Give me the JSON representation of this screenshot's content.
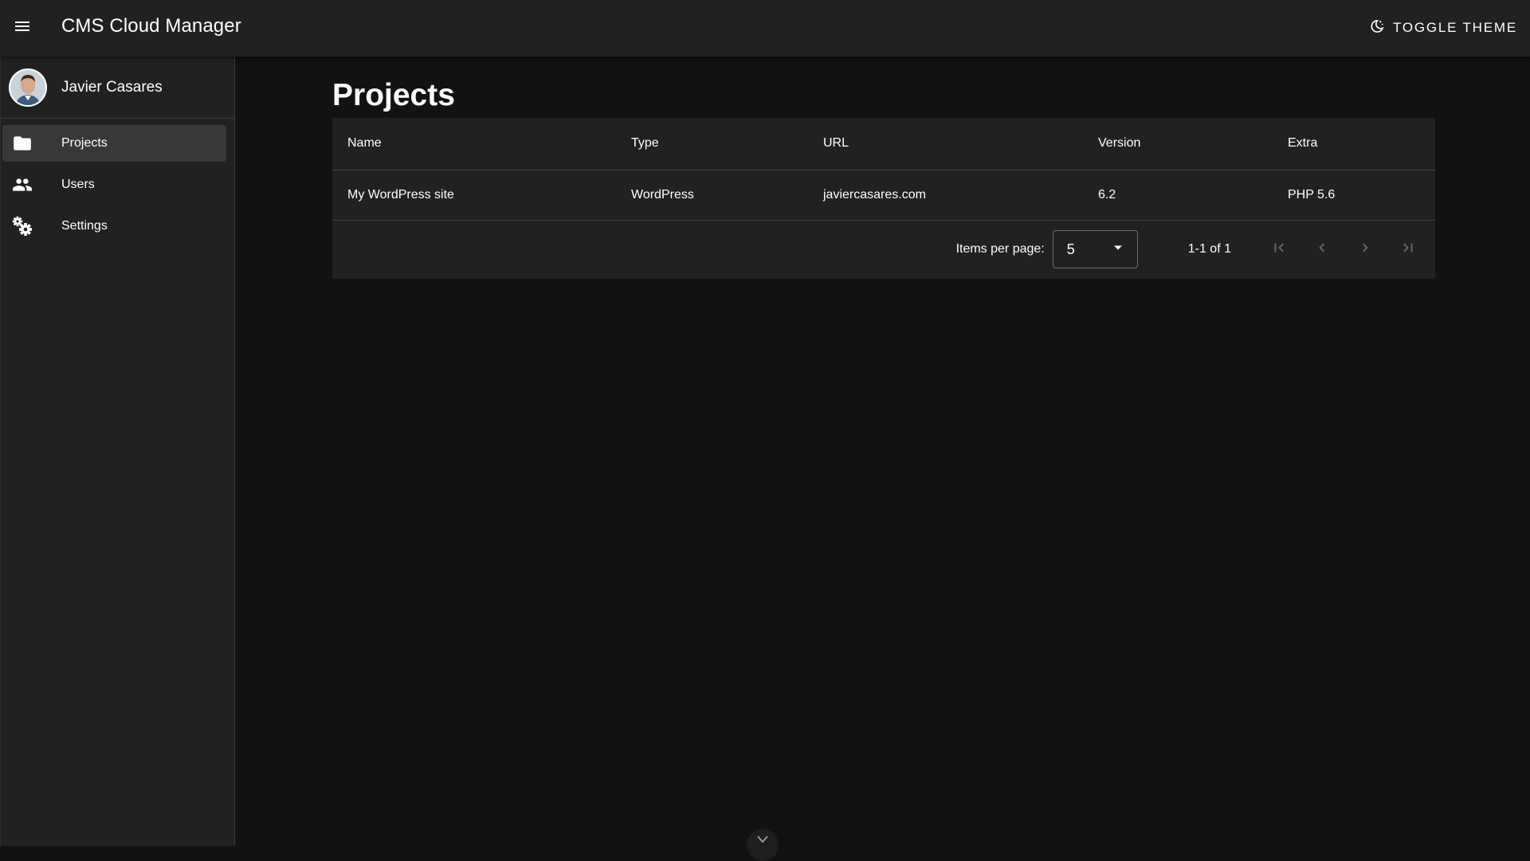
{
  "toolbar": {
    "title": "CMS Cloud Manager",
    "theme_toggle_label": "TOGGLE THEME",
    "menu_icon": "menu-icon",
    "theme_icon": "moon-icon"
  },
  "sidebar": {
    "user_name": "Javier Casares",
    "items": [
      {
        "label": "Projects",
        "icon": "folder-icon",
        "active": true
      },
      {
        "label": "Users",
        "icon": "users-icon",
        "active": false
      },
      {
        "label": "Settings",
        "icon": "settings-icon",
        "active": false
      }
    ]
  },
  "main": {
    "page_title": "Projects",
    "table": {
      "columns": [
        "Name",
        "Type",
        "URL",
        "Version",
        "Extra"
      ],
      "rows": [
        [
          "My WordPress site",
          "WordPress",
          "javiercasares.com",
          "6.2",
          "PHP 5.6"
        ]
      ]
    },
    "paginator": {
      "items_per_page_label": "Items per page:",
      "items_per_page_value": "5",
      "range_label": "1-1 of 1"
    }
  },
  "colors": {
    "background": "#121212",
    "surface": "#212121",
    "active_item": "#383838",
    "text": "#ffffff",
    "disabled_icon": "#6a6a6a"
  }
}
